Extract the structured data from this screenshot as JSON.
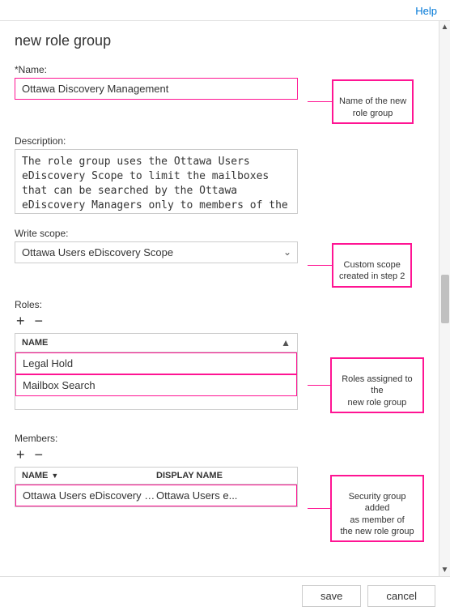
{
  "topbar": {
    "help_label": "Help"
  },
  "page": {
    "title": "new role group"
  },
  "name_field": {
    "label": "*Name:",
    "value": "Ottawa Discovery Management",
    "annotation": "Name of the new\nrole group"
  },
  "description_field": {
    "label": "Description:",
    "value": "The role group uses the Ottawa Users eDiscovery Scope to limit the mailboxes that can be searched by the Ottawa eDiscovery Managers only to members of the Ottawa Users distribution group."
  },
  "write_scope": {
    "label": "Write scope:",
    "value": "Ottawa Users eDiscovery Scope",
    "annotation": "Custom scope\ncreated in step 2",
    "options": [
      "Ottawa Users eDiscovery Scope"
    ]
  },
  "roles_section": {
    "label": "Roles:",
    "add_label": "+",
    "remove_label": "−",
    "table": {
      "column_name": "NAME",
      "rows": [
        {
          "name": "Legal Hold"
        },
        {
          "name": "Mailbox Search"
        }
      ]
    },
    "annotation": "Roles assigned to the\nnew role group"
  },
  "members_section": {
    "label": "Members:",
    "add_label": "+",
    "remove_label": "−",
    "table": {
      "column_name": "NAME",
      "column_display": "DISPLAY NAME",
      "rows": [
        {
          "name": "Ottawa Users eDiscovery Managers",
          "display": "Ottawa Users e..."
        }
      ]
    },
    "annotation": "Security group added\nas member of\nthe new role group"
  },
  "footer": {
    "save_label": "save",
    "cancel_label": "cancel"
  }
}
